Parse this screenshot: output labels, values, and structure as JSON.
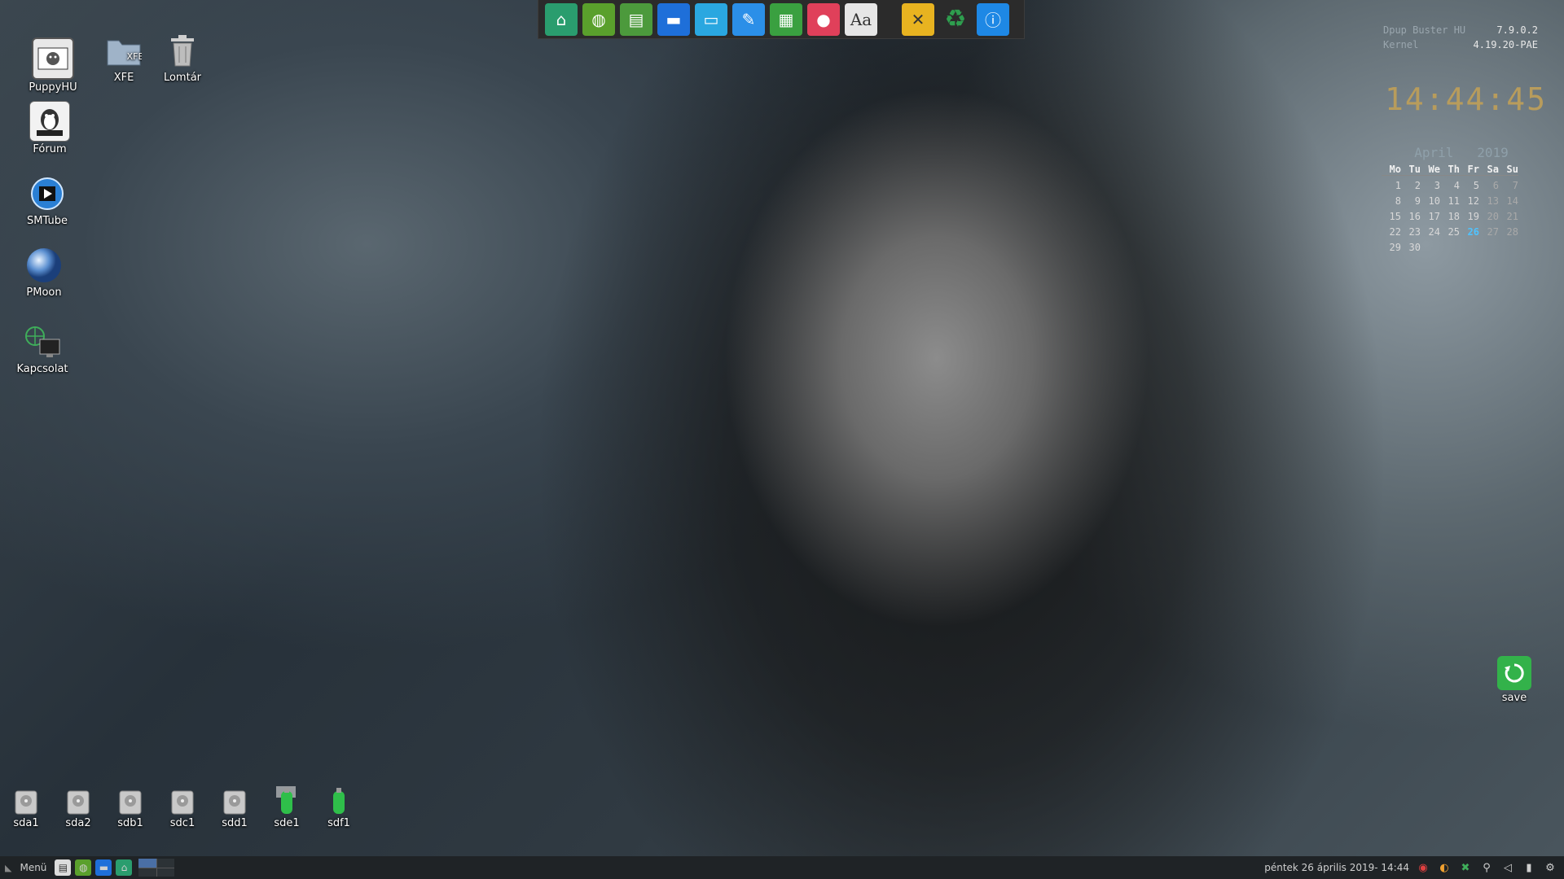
{
  "desktop_icons": [
    {
      "label": "PuppyHU",
      "icon": "puppy-logo-icon"
    },
    {
      "label": "XFE",
      "icon": "folder-icon"
    },
    {
      "label": "Lomtár",
      "icon": "trash-icon"
    },
    {
      "label": "Fórum",
      "icon": "linux-penguin-icon"
    },
    {
      "label": "SMTube",
      "icon": "video-play-icon"
    },
    {
      "label": "PMoon",
      "icon": "moon-icon"
    },
    {
      "label": "Kapcsolat",
      "icon": "network-icon"
    }
  ],
  "drives": [
    "sda1",
    "sda2",
    "sdb1",
    "sdc1",
    "sdd1",
    "sde1",
    "sdf1"
  ],
  "save_label": "save",
  "launcher": [
    {
      "icon": "home-icon",
      "color": "#2a9d6e"
    },
    {
      "icon": "globe-icon",
      "color": "#5aa02c"
    },
    {
      "icon": "chat-icon",
      "color": "#4c9a3c"
    },
    {
      "icon": "monitor-icon",
      "color": "#1e6fd9"
    },
    {
      "icon": "display-settings-icon",
      "color": "#2aa7e0"
    },
    {
      "icon": "image-edit-icon",
      "color": "#2b8fe8"
    },
    {
      "icon": "spreadsheet-icon",
      "color": "#3aa040"
    },
    {
      "icon": "palette-icon",
      "color": "#e0405a"
    },
    {
      "icon": "font-icon",
      "color": "#e6e6e6"
    },
    {
      "icon": "tools-icon",
      "color": "#e8b320"
    },
    {
      "icon": "recycle-icon",
      "color": "#2e9e4e"
    },
    {
      "icon": "info-icon",
      "color": "#1e88e5"
    }
  ],
  "sysinfo": {
    "distro_label": "Dpup Buster HU",
    "distro_version": "7.9.0.2",
    "kernel_label": "Kernel",
    "kernel_version": "4.19.20-PAE"
  },
  "clock": "14:44:45",
  "calendar": {
    "month": "April",
    "year": "2019",
    "weekdays": [
      "Mo",
      "Tu",
      "We",
      "Th",
      "Fr",
      "Sa",
      "Su"
    ],
    "days": [
      "1",
      "2",
      "3",
      "4",
      "5",
      "6",
      "7",
      "8",
      "9",
      "10",
      "11",
      "12",
      "13",
      "14",
      "15",
      "16",
      "17",
      "18",
      "19",
      "20",
      "21",
      "22",
      "23",
      "24",
      "25",
      "26",
      "27",
      "28",
      "29",
      "30"
    ],
    "today": "26"
  },
  "taskbar": {
    "menu_label": "Menü",
    "datetime": "péntek 26 április 2019- 14:44"
  }
}
